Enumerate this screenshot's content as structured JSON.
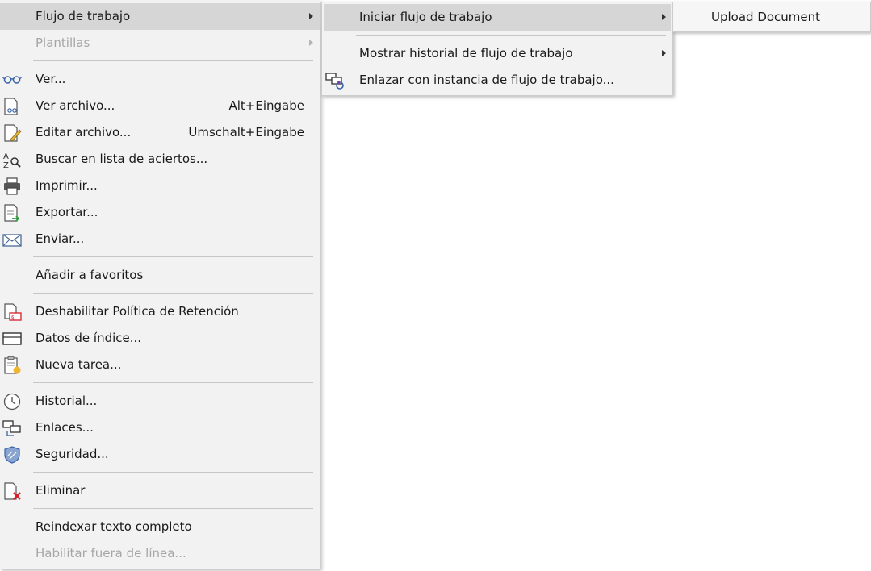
{
  "main_menu": {
    "items": [
      {
        "label": "Flujo de trabajo",
        "submenu": true,
        "highlighted": true
      },
      {
        "label": "Plantillas",
        "submenu": true,
        "disabled": true
      },
      {
        "label": "Ver...",
        "icon": "glasses-icon"
      },
      {
        "label": "Ver archivo...",
        "shortcut": "Alt+Eingabe",
        "icon": "view-file-icon"
      },
      {
        "label": "Editar archivo...",
        "shortcut": "Umschalt+Eingabe",
        "icon": "edit-file-icon"
      },
      {
        "label": "Buscar en lista de aciertos...",
        "icon": "search-az-icon"
      },
      {
        "label": "Imprimir...",
        "icon": "printer-icon"
      },
      {
        "label": "Exportar...",
        "icon": "export-icon"
      },
      {
        "label": "Enviar...",
        "icon": "envelope-icon"
      },
      {
        "label": "Añadir a favoritos"
      },
      {
        "label": "Deshabilitar Política de Retención",
        "icon": "retention-policy-icon"
      },
      {
        "label": "Datos de índice...",
        "icon": "index-data-icon"
      },
      {
        "label": "Nueva tarea...",
        "icon": "new-task-icon"
      },
      {
        "label": "Historial...",
        "icon": "clock-icon"
      },
      {
        "label": "Enlaces...",
        "icon": "links-icon"
      },
      {
        "label": "Seguridad...",
        "icon": "shield-icon"
      },
      {
        "label": "Eliminar",
        "icon": "delete-icon"
      },
      {
        "label": "Reindexar texto completo"
      },
      {
        "label": "Habilitar fuera de línea...",
        "disabled": true
      }
    ]
  },
  "workflow_submenu": {
    "items": [
      {
        "label": "Iniciar flujo de trabajo",
        "submenu": true,
        "highlighted": true
      },
      {
        "label": "Mostrar historial de flujo de trabajo",
        "submenu": true
      },
      {
        "label": "Enlazar con instancia de flujo de trabajo...",
        "icon": "link-workflow-icon"
      }
    ]
  },
  "start_workflow_submenu": {
    "items": [
      {
        "label": "Upload Document"
      }
    ]
  },
  "colors": {
    "menu_background": "#f2f2f2",
    "highlight": "#d6d6d6",
    "disabled_text": "#a6a6a6",
    "icon_blue": "#3a63a8",
    "delete_red": "#d4202a"
  }
}
